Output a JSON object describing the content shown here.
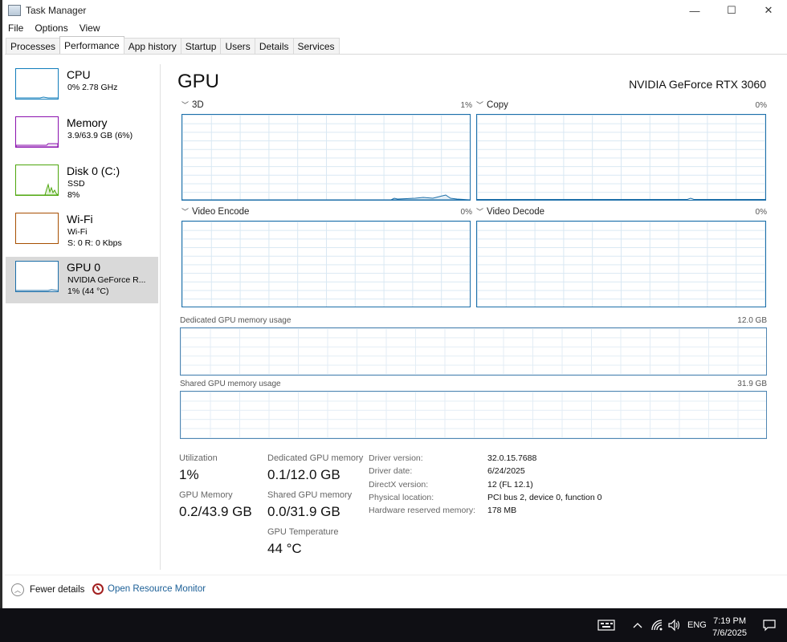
{
  "window": {
    "title": "Task Manager",
    "minimize": "—",
    "maximize": "☐",
    "close": "✕"
  },
  "menu": [
    "File",
    "Options",
    "View"
  ],
  "tabs": [
    "Processes",
    "Performance",
    "App history",
    "Startup",
    "Users",
    "Details",
    "Services"
  ],
  "sidebar": [
    {
      "name": "CPU",
      "sub1": "0%  2.78 GHz",
      "sub2": "",
      "color": "#117dbb"
    },
    {
      "name": "Memory",
      "sub1": "3.9/63.9 GB (6%)",
      "sub2": "",
      "color": "#8b12ae"
    },
    {
      "name": "Disk 0 (C:)",
      "sub1": "SSD",
      "sub2": "8%",
      "color": "#4da60c"
    },
    {
      "name": "Wi-Fi",
      "sub1": "Wi-Fi",
      "sub2": "S: 0  R: 0 Kbps",
      "color": "#a74f01"
    },
    {
      "name": "GPU 0",
      "sub1": "NVIDIA GeForce R...",
      "sub2": "1%  (44 °C)",
      "color": "#1c6fa9"
    }
  ],
  "main": {
    "title": "GPU",
    "device": "NVIDIA GeForce RTX 3060",
    "engines": [
      {
        "label": "3D",
        "percent": "1%"
      },
      {
        "label": "Copy",
        "percent": "0%"
      },
      {
        "label": "Video Encode",
        "percent": "0%"
      },
      {
        "label": "Video Decode",
        "percent": "0%"
      }
    ],
    "dedicated": {
      "label": "Dedicated GPU memory usage",
      "max": "12.0 GB"
    },
    "shared": {
      "label": "Shared GPU memory usage",
      "max": "31.9 GB"
    }
  },
  "stats": {
    "utilization_label": "Utilization",
    "utilization": "1%",
    "gpu_memory_label": "GPU Memory",
    "gpu_memory": "0.2/43.9 GB",
    "dedicated_label": "Dedicated GPU memory",
    "dedicated": "0.1/12.0 GB",
    "shared_label": "Shared GPU memory",
    "shared": "0.0/31.9 GB",
    "temp_label": "GPU Temperature",
    "temp": "44 °C"
  },
  "info": [
    {
      "key": "Driver version:",
      "value": "32.0.15.7688"
    },
    {
      "key": "Driver date:",
      "value": "6/24/2025"
    },
    {
      "key": "DirectX version:",
      "value": "12 (FL 12.1)"
    },
    {
      "key": "Physical location:",
      "value": "PCI bus 2, device 0, function 0"
    },
    {
      "key": "Hardware reserved memory:",
      "value": "178 MB"
    }
  ],
  "footer": {
    "fewer": "Fewer details",
    "resource_monitor": "Open Resource Monitor"
  },
  "taskbar": {
    "lang": "ENG",
    "time": "7:19 PM",
    "date": "7/6/2025"
  }
}
